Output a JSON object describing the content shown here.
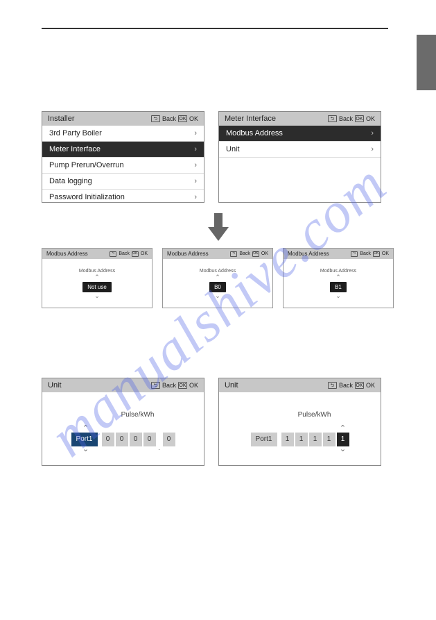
{
  "watermark": "manualshive.com",
  "hdr_icons": {
    "back_box": "⮌",
    "back_text": "Back",
    "ok_box": "OK",
    "ok_text": "OK"
  },
  "installer_panel": {
    "title": "Installer",
    "items": [
      {
        "label": "3rd Party Boiler",
        "selected": false
      },
      {
        "label": "Meter Interface",
        "selected": true
      },
      {
        "label": "Pump Prerun/Overrun",
        "selected": false
      },
      {
        "label": "Data logging",
        "selected": false
      },
      {
        "label": "Password Initialization",
        "selected": false
      }
    ]
  },
  "meter_panel": {
    "title": "Meter Interface",
    "items": [
      {
        "label": "Modbus Address",
        "selected": true
      },
      {
        "label": "Unit",
        "selected": false
      }
    ]
  },
  "modbus_panels": [
    {
      "title": "Modbus Address",
      "label": "Modbus Address",
      "value": "Not use"
    },
    {
      "title": "Modbus Address",
      "label": "Modbus Address",
      "value": "B0"
    },
    {
      "title": "Modbus Address",
      "label": "Modbus Address",
      "value": "B1"
    }
  ],
  "unit_panels": [
    {
      "title": "Unit",
      "label": "Pulse/kWh",
      "port": "Port1",
      "port_active": true,
      "digits": [
        "0",
        "0",
        "0",
        "0",
        "0"
      ],
      "active_index": -1,
      "dot_after": 3
    },
    {
      "title": "Unit",
      "label": "Pulse/kWh",
      "port": "Port1",
      "port_active": false,
      "digits": [
        "1",
        "1",
        "1",
        "1",
        "1"
      ],
      "active_index": 4,
      "dot_after": -1
    }
  ]
}
